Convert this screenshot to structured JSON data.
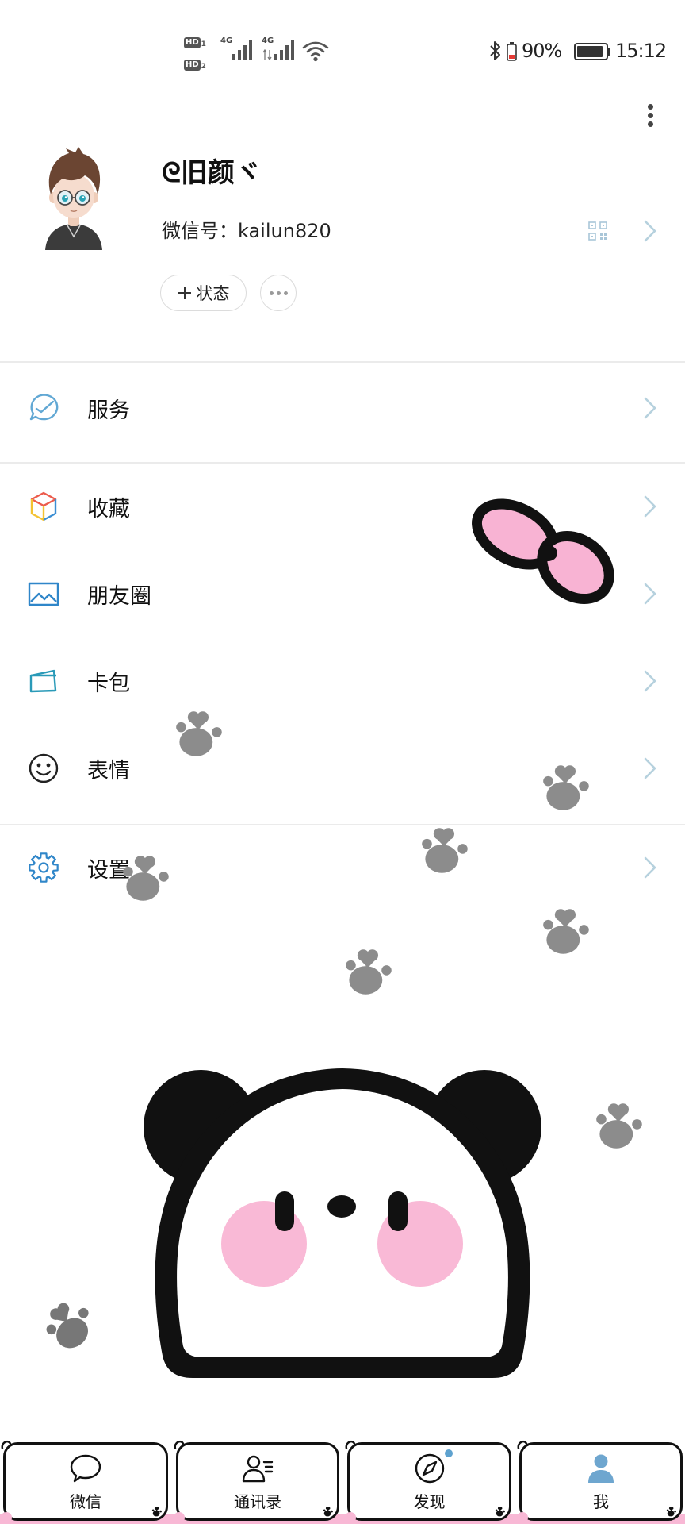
{
  "status_bar": {
    "hd1": "HD",
    "hd1_index": "1",
    "hd2": "HD",
    "hd2_index": "2",
    "net1": "4G",
    "net2": "4G",
    "battery_percent": "90%",
    "time": "15:12",
    "icons": [
      "signal-icon",
      "wifi-icon",
      "bluetooth-icon",
      "battery-low-icon",
      "battery-icon"
    ]
  },
  "header": {
    "more_icon": "more-vertical-icon"
  },
  "profile": {
    "name": "ᘓ旧颜ヾ",
    "wechat_id_label": "微信号：",
    "wechat_id": "kailun820",
    "status_button_label": "状态",
    "status_button_icon": "plus-icon",
    "more_button_icon": "more-horizontal-icon",
    "qr_icon": "qr-code-icon"
  },
  "menu": [
    {
      "label": "服务",
      "icon": "service-icon"
    },
    {
      "label": "收藏",
      "icon": "favorites-cube-icon"
    },
    {
      "label": "朋友圈",
      "icon": "moments-image-icon"
    },
    {
      "label": "卡包",
      "icon": "card-wallet-icon"
    },
    {
      "label": "表情",
      "icon": "sticker-smile-icon"
    },
    {
      "label": "设置",
      "icon": "settings-gear-icon"
    }
  ],
  "tabs": [
    {
      "label": "微信",
      "icon": "chat-bubble-icon",
      "active": false,
      "badge_dot": false
    },
    {
      "label": "通讯录",
      "icon": "contacts-icon",
      "active": false,
      "badge_dot": false
    },
    {
      "label": "发现",
      "icon": "discover-compass-icon",
      "active": false,
      "badge_dot": true
    },
    {
      "label": "我",
      "icon": "me-person-icon",
      "active": true,
      "badge_dot": false
    }
  ],
  "colors": {
    "accent": "#6ea6cf",
    "chevron": "#b6d1de",
    "text": "#111111",
    "divider": "#ebebeb",
    "paw": "#8c8c8c",
    "pink": "#f8b8d5",
    "service": "#62a8d4",
    "moments": "#2f86c9",
    "cards": "#2a9ab8",
    "settings": "#2f86c9",
    "sticker": "#222222"
  }
}
